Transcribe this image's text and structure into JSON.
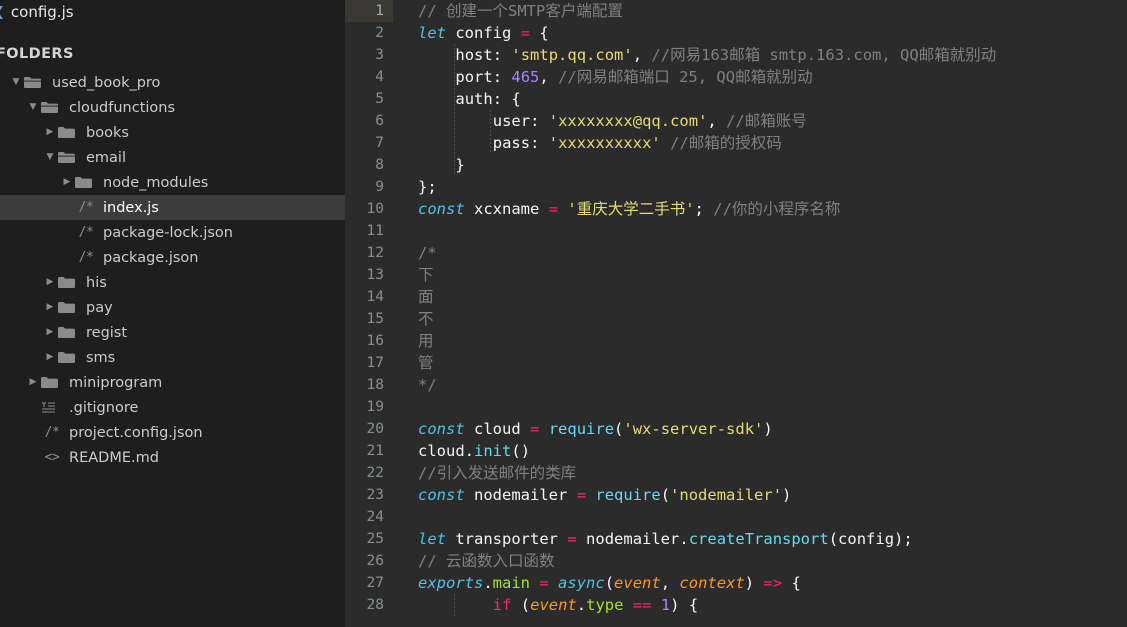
{
  "window": {
    "tab": {
      "label": "config.js",
      "icon": "chevron-left-icon"
    },
    "sidebar_title": "FOLDERS"
  },
  "sidebar": {
    "items": [
      {
        "label": "used_book_pro",
        "depth": 0,
        "icon": "folder-open-icon",
        "twisty": "down",
        "selected": false
      },
      {
        "label": "cloudfunctions",
        "depth": 1,
        "icon": "folder-open-icon",
        "twisty": "down",
        "selected": false
      },
      {
        "label": "books",
        "depth": 2,
        "icon": "folder-icon",
        "twisty": "right",
        "selected": false
      },
      {
        "label": "email",
        "depth": 2,
        "icon": "folder-open-icon",
        "twisty": "down",
        "selected": false
      },
      {
        "label": "node_modules",
        "depth": 3,
        "icon": "folder-icon",
        "twisty": "right",
        "selected": false
      },
      {
        "label": "index.js",
        "depth": 3,
        "icon": "js-file-icon",
        "twisty": "none",
        "selected": true
      },
      {
        "label": "package-lock.json",
        "depth": 3,
        "icon": "js-file-icon",
        "twisty": "none",
        "selected": false
      },
      {
        "label": "package.json",
        "depth": 3,
        "icon": "js-file-icon",
        "twisty": "none",
        "selected": false
      },
      {
        "label": "his",
        "depth": 2,
        "icon": "folder-icon",
        "twisty": "right",
        "selected": false
      },
      {
        "label": "pay",
        "depth": 2,
        "icon": "folder-icon",
        "twisty": "right",
        "selected": false
      },
      {
        "label": "regist",
        "depth": 2,
        "icon": "folder-icon",
        "twisty": "right",
        "selected": false
      },
      {
        "label": "sms",
        "depth": 2,
        "icon": "folder-icon",
        "twisty": "right",
        "selected": false
      },
      {
        "label": "miniprogram",
        "depth": 1,
        "icon": "folder-icon",
        "twisty": "right",
        "selected": false
      },
      {
        "label": ".gitignore",
        "depth": 1,
        "icon": "text-file-icon",
        "twisty": "none",
        "selected": false
      },
      {
        "label": "project.config.json",
        "depth": 1,
        "icon": "js-file-icon",
        "twisty": "none",
        "selected": false
      },
      {
        "label": "README.md",
        "depth": 1,
        "icon": "markup-file-icon",
        "twisty": "none",
        "selected": false
      }
    ]
  },
  "editor": {
    "current_line": 1,
    "first_line_number": 1,
    "last_line_number": 28,
    "line_numbers": [
      1,
      2,
      3,
      4,
      5,
      6,
      7,
      8,
      9,
      10,
      11,
      12,
      13,
      14,
      15,
      16,
      17,
      18,
      19,
      20,
      21,
      22,
      23,
      24,
      25,
      26,
      27,
      28
    ],
    "lines": [
      {
        "n": 1,
        "text": "// 创建一个SMTP客户端配置"
      },
      {
        "n": 2,
        "text": "let config = {"
      },
      {
        "n": 3,
        "text": "    host: 'smtp.qq.com', //网易163邮箱 smtp.163.com, QQ邮箱就别动"
      },
      {
        "n": 4,
        "text": "    port: 465, //网易邮箱端口 25, QQ邮箱就别动"
      },
      {
        "n": 5,
        "text": "    auth: {"
      },
      {
        "n": 6,
        "text": "        user: 'xxxxxxxx@qq.com', //邮箱账号"
      },
      {
        "n": 7,
        "text": "        pass: 'xxxxxxxxxx' //邮箱的授权码"
      },
      {
        "n": 8,
        "text": "    }"
      },
      {
        "n": 9,
        "text": "};"
      },
      {
        "n": 10,
        "text": "const xcxname = '重庆大学二手书'; //你的小程序名称"
      },
      {
        "n": 11,
        "text": ""
      },
      {
        "n": 12,
        "text": "/*"
      },
      {
        "n": 13,
        "text": "下"
      },
      {
        "n": 14,
        "text": "面"
      },
      {
        "n": 15,
        "text": "不"
      },
      {
        "n": 16,
        "text": "用"
      },
      {
        "n": 17,
        "text": "管"
      },
      {
        "n": 18,
        "text": "*/"
      },
      {
        "n": 19,
        "text": ""
      },
      {
        "n": 20,
        "text": "const cloud = require('wx-server-sdk')"
      },
      {
        "n": 21,
        "text": "cloud.init()"
      },
      {
        "n": 22,
        "text": "//引入发送邮件的类库"
      },
      {
        "n": 23,
        "text": "const nodemailer = require('nodemailer')"
      },
      {
        "n": 24,
        "text": ""
      },
      {
        "n": 25,
        "text": "let transporter = nodemailer.createTransport(config);"
      },
      {
        "n": 26,
        "text": "// 云函数入口函数"
      },
      {
        "n": 27,
        "text": "exports.main = async(event, context) => {"
      },
      {
        "n": 28,
        "text": "        if (event.type == 1) {"
      }
    ]
  },
  "colors": {
    "sidebar_bg": "#1e1e1e",
    "editor_bg": "#2b2b2b",
    "selection_bg": "#3c3c3c",
    "current_line_gutter_bg": "#3a3a32",
    "comment": "#808080",
    "keyword": "#4fc1e9",
    "control": "#f92672",
    "operator": "#f92672",
    "function": "#66d9ef",
    "string": "#e6db74",
    "number": "#ae81ff",
    "property": "#a6e22e",
    "parameter": "#fd971f",
    "text": "#f5f5f5"
  }
}
